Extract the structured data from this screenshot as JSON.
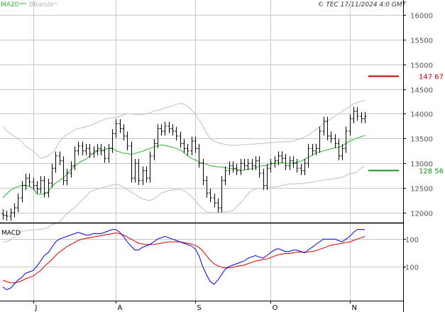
{
  "header": {
    "legend_ma20": "MA20",
    "legend_bbands": "BBands",
    "source": "© TEC 17/11/2024 4:0 GMT"
  },
  "colors": {
    "background": "#ffffff",
    "grid": "#c8c8c8",
    "price_bars": "#000000",
    "ma20": "#2db52d",
    "bbands": "#c0c0c0",
    "resistance": "#cc0000",
    "support": "#119911",
    "macd_line": "#0000dd",
    "signal_line": "#dd0000"
  },
  "chart_data": [
    {
      "type": "ohlc",
      "panel": "price",
      "y_ticks": [
        12000,
        12500,
        13000,
        13500,
        14000,
        14500,
        15000,
        15500,
        16000
      ],
      "y_tick_labels": [
        "12000",
        "12500",
        "13000",
        "13500",
        "14000",
        "14500",
        "15000",
        "15500",
        "16000"
      ],
      "ylim": [
        11800,
        16300
      ],
      "x_tick_labels": [
        "J",
        "A",
        "S",
        "O",
        "N"
      ],
      "x_tick_index": [
        8,
        30,
        51,
        71,
        92
      ],
      "levels": [
        {
          "name": "resistance",
          "value": 14767,
          "label": "147 67",
          "color": "#cc0000"
        },
        {
          "name": "support",
          "value": 12856,
          "label": "128 56",
          "color": "#119911"
        }
      ],
      "close": [
        11950,
        11930,
        12000,
        12100,
        12300,
        12550,
        12700,
        12620,
        12550,
        12480,
        12650,
        12400,
        12600,
        12900,
        13150,
        13050,
        12650,
        12800,
        12950,
        13250,
        13350,
        13250,
        13300,
        13200,
        13250,
        13300,
        13250,
        13100,
        13300,
        13600,
        13800,
        13700,
        13550,
        13350,
        12700,
        13000,
        12650,
        12850,
        12700,
        13150,
        13400,
        13700,
        13650,
        13750,
        13700,
        13650,
        13550,
        13400,
        13300,
        13250,
        13450,
        13300,
        13000,
        12650,
        12400,
        12300,
        12200,
        12100,
        12650,
        12850,
        12950,
        12900,
        12850,
        13000,
        12950,
        13000,
        12950,
        13050,
        12800,
        12550,
        12900,
        13000,
        13050,
        13150,
        13100,
        12950,
        13050,
        13000,
        12900,
        12850,
        13000,
        13300,
        13250,
        13300,
        13650,
        13850,
        13550,
        13500,
        13400,
        13150,
        13300,
        13650,
        13900,
        14050,
        13950,
        13900,
        13950
      ],
      "ma20": [
        12300,
        12380,
        12450,
        12500,
        12530,
        12550,
        12560,
        12530,
        12500,
        12380,
        12370,
        12380,
        12420,
        12530,
        12600,
        12650,
        12700,
        12780,
        12870,
        12940,
        13000,
        13050,
        13080,
        13150,
        13200,
        13240,
        13270,
        13280,
        13300,
        13310,
        13250,
        13230,
        13200,
        13200,
        13180,
        13200,
        13220,
        13240,
        13270,
        13300,
        13330,
        13350,
        13370,
        13360,
        13340,
        13320,
        13300,
        13270,
        13220,
        13150,
        13100,
        13070,
        13030,
        13000,
        12980,
        12950,
        12940,
        12930,
        12920,
        12910,
        12900,
        12880,
        12880,
        12860,
        12860,
        12880,
        12890,
        12910,
        12940,
        12950,
        12960,
        12980,
        13000,
        13010,
        13010,
        13000,
        13000,
        13010,
        13020,
        13040,
        13080,
        13120,
        13160,
        13210,
        13230,
        13250,
        13270,
        13290,
        13310,
        13320,
        13350,
        13400,
        13450,
        13480,
        13510,
        13540,
        13560
      ],
      "bb_upper": [
        13750,
        13650,
        13600,
        13550,
        13500,
        13430,
        13350,
        13300,
        13250,
        13170,
        13100,
        13120,
        13150,
        13200,
        13300,
        13430,
        13530,
        13580,
        13620,
        13680,
        13700,
        13720,
        13740,
        13760,
        13790,
        13820,
        13860,
        13890,
        13910,
        13920,
        13930,
        13950,
        13980,
        14000,
        14000,
        13990,
        13980,
        13990,
        14000,
        14020,
        14050,
        14070,
        14090,
        14120,
        14140,
        14160,
        14190,
        14210,
        14200,
        14150,
        14080,
        14000,
        13880,
        13760,
        13620,
        13500,
        13450,
        13420,
        13400,
        13380,
        13370,
        13360,
        13360,
        13370,
        13380,
        13380,
        13390,
        13390,
        13400,
        13400,
        13410,
        13420,
        13420,
        13430,
        13430,
        13440,
        13440,
        13450,
        13470,
        13500,
        13530,
        13570,
        13620,
        13680,
        13740,
        13800,
        13850,
        13900,
        13950,
        14000,
        14050,
        14100,
        14150,
        14200,
        14230,
        14250,
        14260
      ],
      "bb_lower": [
        11400,
        11420,
        11450,
        11500,
        11560,
        11620,
        11640,
        11650,
        11650,
        11660,
        11660,
        11680,
        11700,
        11760,
        11780,
        11810,
        11900,
        11980,
        12050,
        12100,
        12180,
        12260,
        12320,
        12420,
        12450,
        12480,
        12500,
        12520,
        12540,
        12560,
        12580,
        12560,
        12520,
        12470,
        12420,
        12380,
        12320,
        12280,
        12260,
        12250,
        12280,
        12330,
        12400,
        12420,
        12450,
        12460,
        12470,
        12470,
        12450,
        12400,
        12330,
        12250,
        12150,
        12080,
        12020,
        12000,
        12000,
        12000,
        12010,
        12020,
        12020,
        12050,
        12120,
        12200,
        12280,
        12380,
        12450,
        12480,
        12500,
        12500,
        12510,
        12520,
        12520,
        12530,
        12550,
        12570,
        12580,
        12580,
        12590,
        12590,
        12600,
        12610,
        12620,
        12630,
        12650,
        12660,
        12670,
        12680,
        12690,
        12700,
        12720,
        12750,
        12790,
        12800,
        12830,
        12900,
        12950
      ]
    },
    {
      "type": "line",
      "panel": "macd",
      "title": "MACD",
      "y_ticks": [
        100,
        -100
      ],
      "y_tick_labels": [
        "100",
        "-100"
      ],
      "ylim": [
        -350,
        210
      ],
      "series": [
        {
          "name": "MACD",
          "color": "#0000dd",
          "values": [
            -250,
            -270,
            -260,
            -230,
            -200,
            -180,
            -150,
            -140,
            -130,
            -100,
            -60,
            -20,
            0,
            40,
            80,
            100,
            110,
            120,
            130,
            140,
            150,
            140,
            130,
            130,
            140,
            140,
            140,
            150,
            160,
            170,
            170,
            150,
            120,
            80,
            50,
            20,
            20,
            40,
            50,
            60,
            80,
            100,
            110,
            120,
            110,
            100,
            90,
            80,
            70,
            60,
            50,
            30,
            -20,
            -100,
            -160,
            -210,
            -230,
            -200,
            -160,
            -120,
            -100,
            -90,
            -80,
            -70,
            -60,
            -40,
            -30,
            -20,
            -30,
            -40,
            -20,
            0,
            20,
            30,
            20,
            10,
            10,
            20,
            20,
            10,
            0,
            20,
            40,
            60,
            80,
            100,
            100,
            100,
            100,
            90,
            80,
            100,
            120,
            150,
            170,
            170,
            170
          ]
        },
        {
          "name": "Signal",
          "color": "#dd0000",
          "values": [
            -200,
            -210,
            -220,
            -220,
            -215,
            -205,
            -190,
            -180,
            -170,
            -150,
            -130,
            -100,
            -75,
            -50,
            -20,
            5,
            25,
            45,
            60,
            75,
            90,
            100,
            105,
            110,
            115,
            120,
            125,
            130,
            135,
            140,
            145,
            140,
            130,
            115,
            100,
            85,
            70,
            65,
            60,
            60,
            60,
            65,
            70,
            75,
            80,
            80,
            80,
            80,
            75,
            70,
            65,
            55,
            40,
            15,
            -20,
            -55,
            -80,
            -95,
            -105,
            -110,
            -110,
            -105,
            -100,
            -95,
            -90,
            -80,
            -70,
            -60,
            -55,
            -50,
            -45,
            -35,
            -25,
            -15,
            -10,
            -5,
            -5,
            0,
            5,
            5,
            5,
            5,
            10,
            15,
            25,
            35,
            45,
            55,
            60,
            65,
            70,
            75,
            80,
            90,
            100,
            110,
            120
          ]
        }
      ]
    }
  ]
}
